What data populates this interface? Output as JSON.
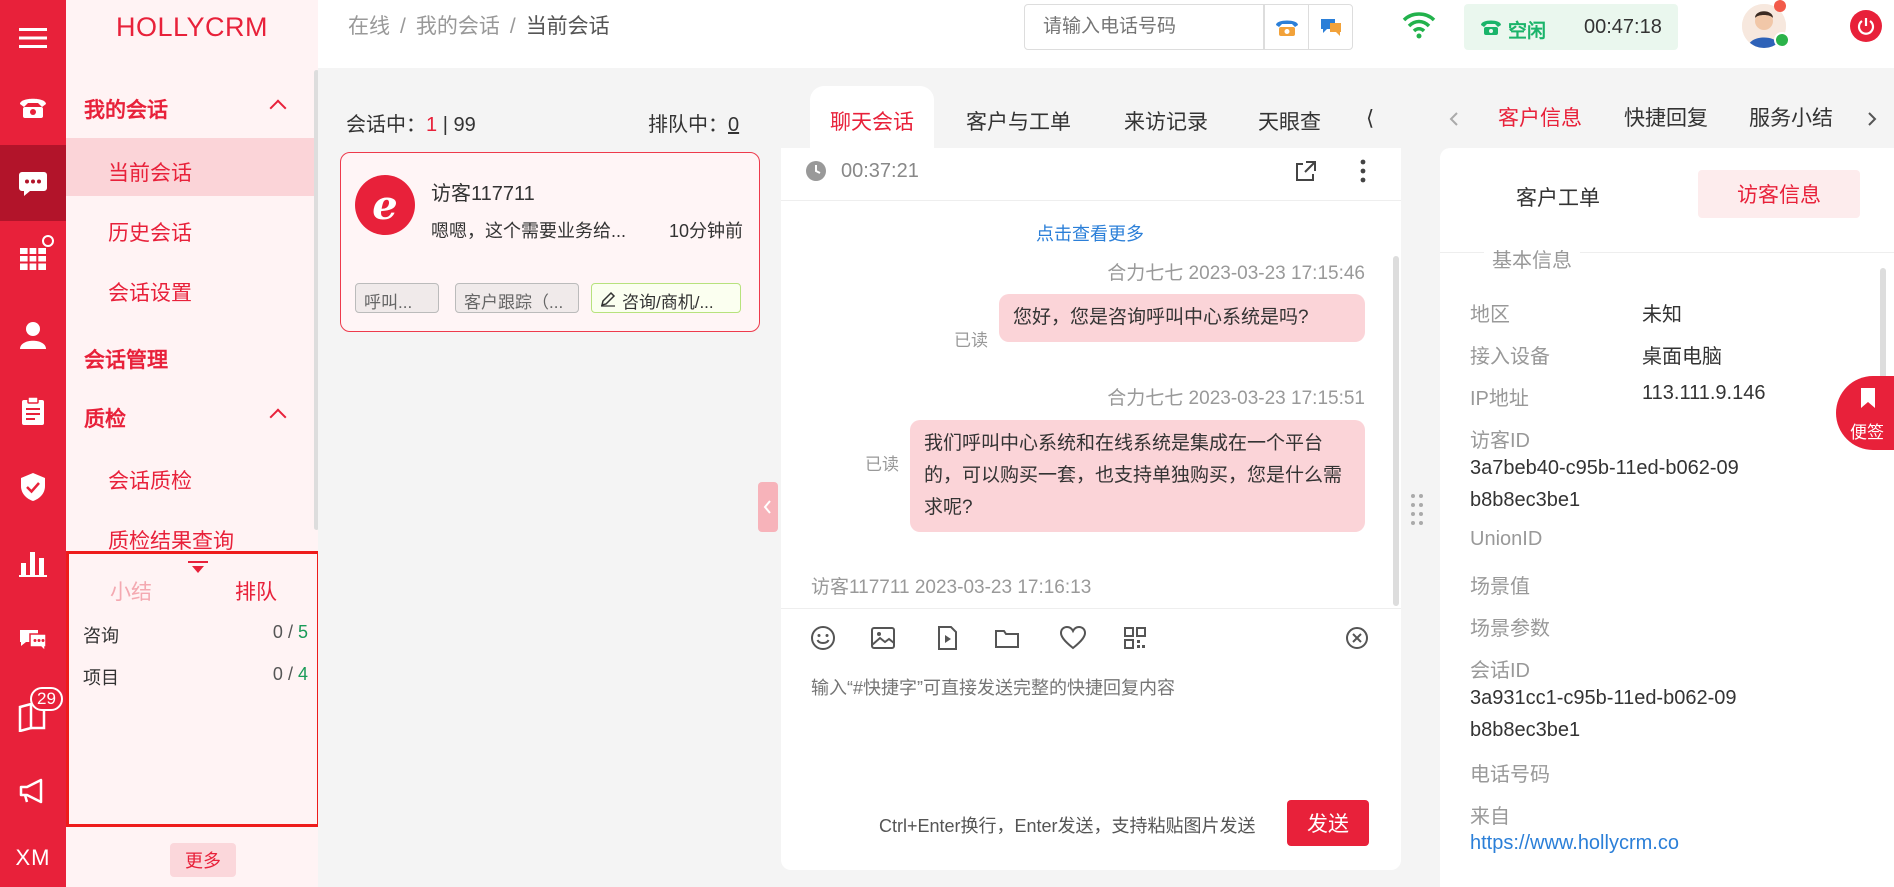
{
  "app": {
    "brand": "HOLLYCRM"
  },
  "rail": {
    "message_badge": "29",
    "bottom_label": "XM"
  },
  "sidebar": {
    "groups": [
      {
        "label": "我的会话",
        "items": [
          "当前会话",
          "历史会话",
          "会话设置"
        ]
      },
      {
        "label": "会话管理",
        "items": []
      },
      {
        "label": "质检",
        "items": [
          "会话质检",
          "质检结果查询"
        ]
      }
    ],
    "summary": {
      "tabs": [
        "小结",
        "排队"
      ],
      "rows": [
        {
          "label": "咨询",
          "count": "0",
          "total": "5"
        },
        {
          "label": "项目",
          "count": "0",
          "total": "4"
        }
      ]
    },
    "more_label": "更多"
  },
  "header": {
    "breadcrumb": [
      "在线",
      "我的会话",
      "当前会话"
    ],
    "phone_placeholder": "请输入电话号码",
    "status": "空闲",
    "timer": "00:47:18"
  },
  "session_list": {
    "in_session_label": "会话中：",
    "in_session_count": "1",
    "in_session_sep": "|",
    "in_session_max": "99",
    "queue_label": "排队中：",
    "queue_count": "0",
    "card": {
      "name": "访客117711",
      "preview": "嗯嗯，这个需要业务给...",
      "time": "10分钟前",
      "tags": [
        "呼叫...",
        "客户跟踪（...",
        "咨询/商机/..."
      ]
    }
  },
  "chat": {
    "tabs": [
      "聊天会话",
      "客户与工单",
      "来访记录",
      "天眼查"
    ],
    "duration": "00:37:21",
    "load_more": "点击查看更多",
    "messages": [
      {
        "meta": "合力七七 2023-03-23 17:15:46",
        "text": "您好，您是咨询呼叫中心系统是吗?",
        "read": "已读"
      },
      {
        "meta": "合力七七 2023-03-23 17:15:51",
        "text": "我们呼叫中心系统和在线系统是集成在一个平台的，可以购买一套，也支持单独购买，您是什么需求呢?",
        "read": "已读"
      }
    ],
    "visitor_meta": "访客117711 2023-03-23 17:16:13",
    "input_placeholder": "输入“#快捷字”可直接发送完整的快捷回复内容",
    "hint": "Ctrl+Enter换行，Enter发送，支持粘贴图片发送",
    "send_label": "发送"
  },
  "right": {
    "tabs": [
      "客户信息",
      "快捷回复",
      "服务小结"
    ],
    "subtabs": [
      "客户工单",
      "访客信息"
    ],
    "section": "基本信息",
    "fields": {
      "region_label": "地区",
      "region": "未知",
      "device_label": "接入设备",
      "device": "桌面电脑",
      "ip_label": "IP地址",
      "ip": "113.111.9.146",
      "visitor_id_label": "访客ID",
      "visitor_id": "3a7beb40-c95b-11ed-b062-09b8b8ec3be1",
      "unionid_label": "UnionID",
      "scene_value_label": "场景值",
      "scene_params_label": "场景参数",
      "session_id_label": "会话ID",
      "session_id": "3a931cc1-c95b-11ed-b062-09b8b8ec3be1",
      "phone_label": "电话号码",
      "from_label": "来自",
      "from": "https://www.hollycrm.co"
    },
    "sticky_label": "便签"
  },
  "colors": {
    "brand": "#e8213a",
    "idle_green": "#1ab46a",
    "link": "#2b7fd8"
  }
}
